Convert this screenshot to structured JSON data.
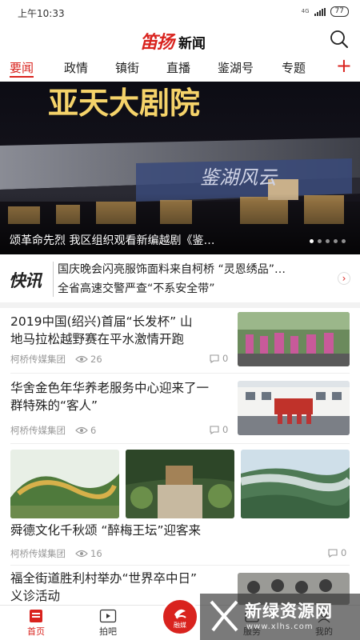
{
  "status_bar": {
    "time": "上午10:33",
    "network": "4G",
    "battery": "77"
  },
  "header": {
    "brand": "笛扬",
    "title": "新闻"
  },
  "tabs": [
    {
      "label": "要闻",
      "active": true
    },
    {
      "label": "政情"
    },
    {
      "label": "镇街"
    },
    {
      "label": "直播"
    },
    {
      "label": "鉴湖号"
    },
    {
      "label": "专题"
    }
  ],
  "tabs_add": "+",
  "banner": {
    "caption": "颂革命先烈 我区组织观看新编越剧《鉴…",
    "sign_text": "亚天大剧院",
    "overlay_text": "鉴湖风云",
    "dots": 5,
    "active_dot": 0
  },
  "flash": {
    "logo": "快讯",
    "items": [
      "国庆晚会闪亮服饰面料来自柯桥 “灵恩绣品”…",
      "全省高速交警严查“不系安全带”"
    ]
  },
  "articles": [
    {
      "title_lines": [
        "2019中国(绍兴)首届“长发杯” 山",
        "地马拉松越野赛在平水激情开跑"
      ],
      "source": "柯桥传媒集团",
      "views": "26",
      "comments": "0"
    },
    {
      "title_lines": [
        "华舍金色年华养老服务中心迎来了一",
        "群特殊的“客人”"
      ],
      "source": "柯桥传媒集团",
      "views": "6",
      "comments": "0"
    },
    {
      "title_lines": [
        "舜德文化千秋颂 “醉梅王坛”迎客来"
      ],
      "source": "柯桥传媒集团",
      "views": "16",
      "comments": "0"
    },
    {
      "title_lines": [
        "福全街道胜利村举办“世界卒中日”",
        "义诊活动"
      ]
    }
  ],
  "bottom_nav": [
    {
      "label": "首页",
      "active": true
    },
    {
      "label": "拍吧"
    },
    {
      "label": "融媒"
    },
    {
      "label": "服务"
    },
    {
      "label": "我的"
    }
  ],
  "watermark": {
    "title": "新绿资源网",
    "url": "www.xlhs.com"
  },
  "colors": {
    "accent": "#d9231e",
    "text": "#222222",
    "meta": "#999999"
  }
}
